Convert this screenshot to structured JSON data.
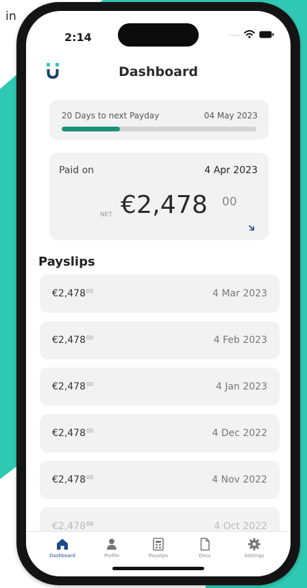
{
  "corner_word": "in",
  "status": {
    "time": "2:14",
    "signal_text": "....",
    "icons": [
      "wifi-icon",
      "battery-icon"
    ]
  },
  "header": {
    "title": "Dashboard",
    "logo": "u-logo-icon"
  },
  "payday": {
    "label": "20 Days to next Payday",
    "date": "04 May 2023",
    "progress": 0.3
  },
  "paid": {
    "label": "Paid on",
    "date": "4 Apr 2023",
    "net_label": "NET",
    "amount": "€2,478",
    "cents": "00",
    "arrow_icon": "arrow-down-right-icon"
  },
  "payslips": {
    "title": "Payslips",
    "items": [
      {
        "amount": "€2,478",
        "cents": "00",
        "date": "4 Mar 2023"
      },
      {
        "amount": "€2,478",
        "cents": "00",
        "date": "4 Feb 2023"
      },
      {
        "amount": "€2,478",
        "cents": "00",
        "date": "4 Jan 2023"
      },
      {
        "amount": "€2,478",
        "cents": "00",
        "date": "4 Dec 2022"
      },
      {
        "amount": "€2,478",
        "cents": "00",
        "date": "4 Nov 2022"
      },
      {
        "amount": "€2,478",
        "cents": "00",
        "date": "4 Oct 2022"
      }
    ]
  },
  "tabs": [
    {
      "label": "Dashboard",
      "icon": "home-icon",
      "active": true
    },
    {
      "label": "Profile",
      "icon": "person-icon",
      "active": false
    },
    {
      "label": "Payslips",
      "icon": "payslip-icon",
      "active": false
    },
    {
      "label": "Docs",
      "icon": "document-icon",
      "active": false
    },
    {
      "label": "Settings",
      "icon": "gear-icon",
      "active": false
    }
  ],
  "colors": {
    "teal": "#2fc9b3",
    "accent_green": "#1b9277",
    "active_tab": "#1f4a8a",
    "card_bg": "#f2f2f2"
  }
}
